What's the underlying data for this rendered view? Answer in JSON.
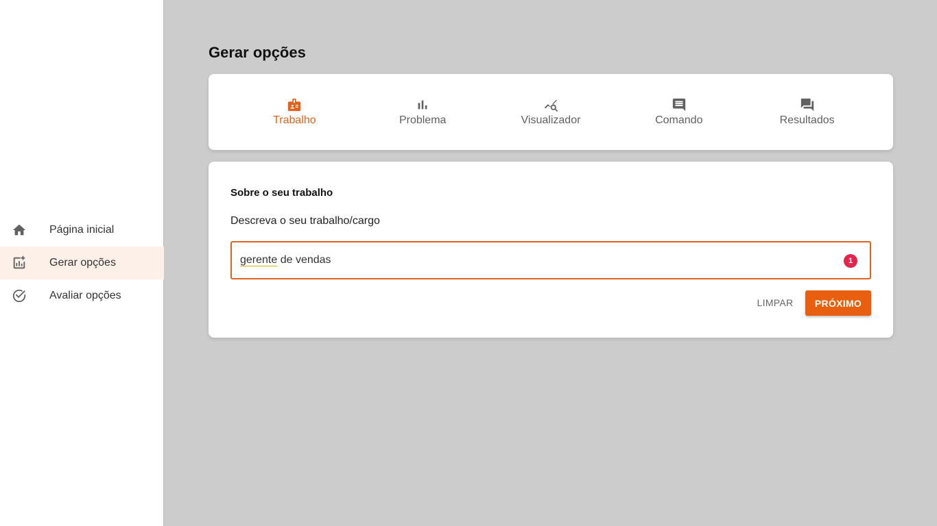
{
  "sidebar": {
    "items": [
      {
        "label": "Página inicial",
        "icon": "home-icon",
        "active": false
      },
      {
        "label": "Gerar opções",
        "icon": "add-chart-icon",
        "active": true
      },
      {
        "label": "Avaliar opções",
        "icon": "check-circle-icon",
        "active": false
      }
    ]
  },
  "page": {
    "title": "Gerar opções"
  },
  "stepper": {
    "steps": [
      {
        "label": "Trabalho",
        "icon": "badge-icon",
        "active": true
      },
      {
        "label": "Problema",
        "icon": "bar-chart-icon",
        "active": false
      },
      {
        "label": "Visualizador",
        "icon": "query-stats-icon",
        "active": false
      },
      {
        "label": "Comando",
        "icon": "comment-icon",
        "active": false
      },
      {
        "label": "Resultados",
        "icon": "forum-icon",
        "active": false
      }
    ]
  },
  "form": {
    "heading": "Sobre o seu trabalho",
    "description": "Descreva o seu trabalho/cargo",
    "input": {
      "value_first_word": "gerente",
      "value_rest": " de vendas",
      "badge_count": "1"
    },
    "clear_label": "LIMPAR",
    "next_label": "PRÓXIMO"
  },
  "colors": {
    "accent": "#e8600f",
    "badge": "#e2264b",
    "background": "#cccccc"
  }
}
